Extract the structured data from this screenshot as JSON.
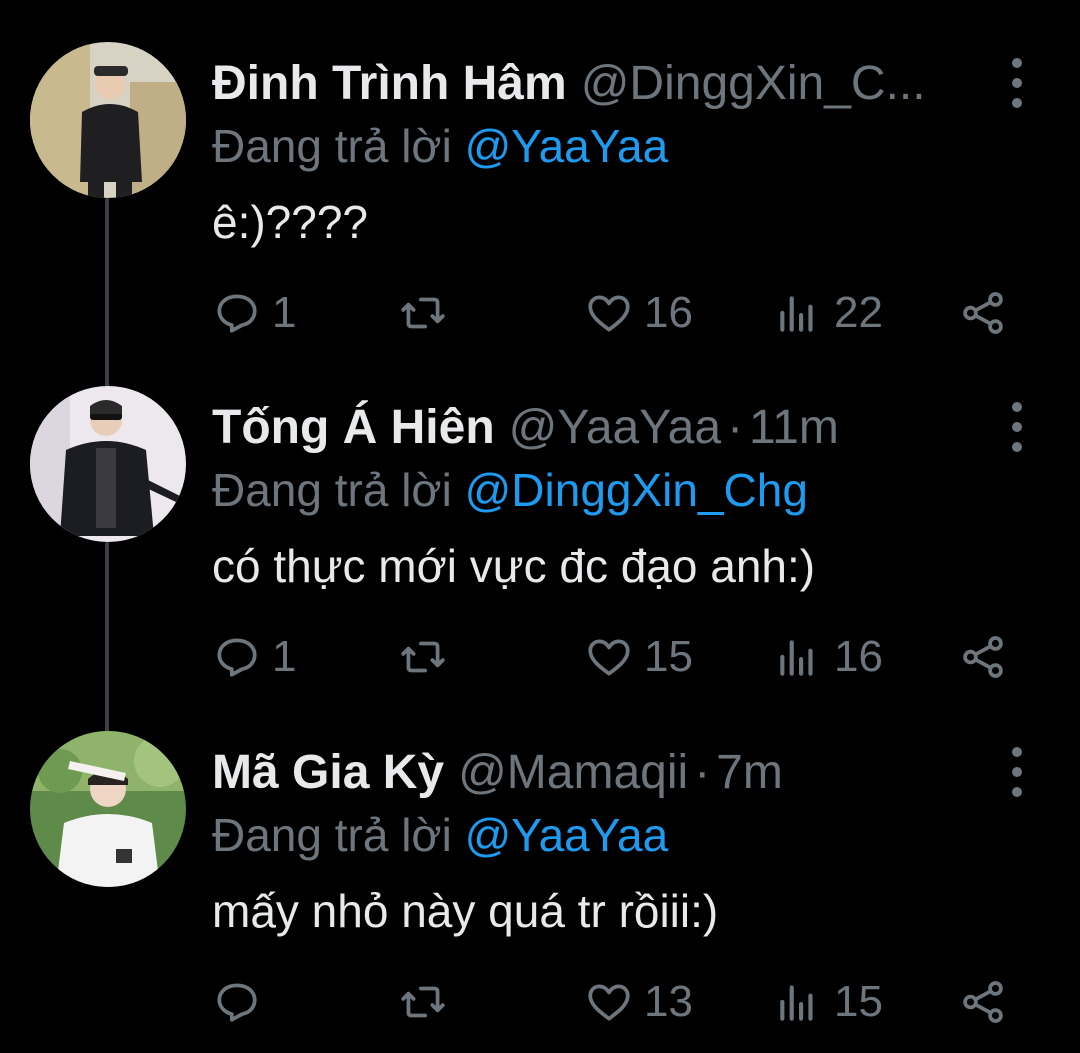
{
  "colors": {
    "background": "#000000",
    "text_primary": "#e7e9ea",
    "text_secondary": "#6e767d",
    "accent": "#1d9bf0",
    "thread_line": "#3b3f44"
  },
  "tweets": [
    {
      "name": "Đinh Trình Hâm",
      "handle": "@DinggXin_C...",
      "dot": "",
      "time": "",
      "reply_prefix": "Đang trả lời",
      "reply_mention": "@YaaYaa",
      "text": "ê:)????",
      "replies": "1",
      "retweets": "",
      "likes": "16",
      "views": "22",
      "icons": [
        "reply-icon",
        "retweet-icon",
        "like-icon",
        "views-icon",
        "share-icon",
        "more-icon"
      ]
    },
    {
      "name": "Tống Á Hiên",
      "handle": "@YaaYaa",
      "dot": "·",
      "time": "11m",
      "reply_prefix": "Đang trả lời",
      "reply_mention": "@DinggXin_Chg",
      "text": "có thực mới vực đc đạo anh:)",
      "replies": "1",
      "retweets": "",
      "likes": "15",
      "views": "16",
      "icons": [
        "reply-icon",
        "retweet-icon",
        "like-icon",
        "views-icon",
        "share-icon",
        "more-icon"
      ]
    },
    {
      "name": "Mã Gia Kỳ",
      "handle": "@Mamaqii",
      "dot": "·",
      "time": "7m",
      "reply_prefix": "Đang trả lời",
      "reply_mention": "@YaaYaa",
      "text": "mấy nhỏ này quá tr rồiii:)",
      "replies": "",
      "retweets": "",
      "likes": "13",
      "views": "15",
      "icons": [
        "reply-icon",
        "retweet-icon",
        "like-icon",
        "views-icon",
        "share-icon",
        "more-icon"
      ]
    }
  ]
}
